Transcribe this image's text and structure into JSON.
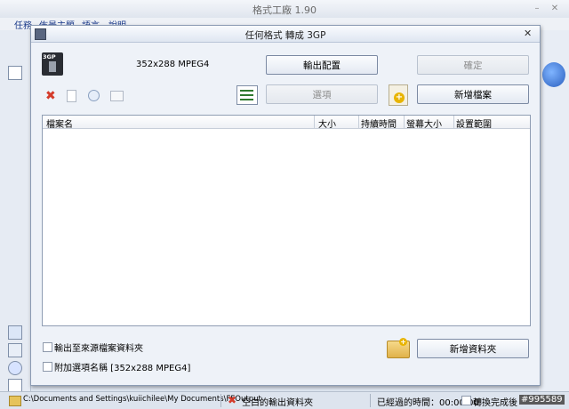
{
  "main_window": {
    "title": "格式工廠 1.90",
    "min_btn": "–",
    "close_btn": "✕",
    "menu": [
      "任務",
      "佈景主題",
      "語言",
      "說明"
    ]
  },
  "dialog": {
    "title": "任何格式 轉成 3GP",
    "format_badge": "3GP",
    "format_info": "352x288 MPEG4",
    "close_btn": "✕",
    "buttons": {
      "output_config": "輸出配置",
      "ok": "確定",
      "options": "選項",
      "add_file": "新增檔案",
      "add_folder": "新增資料夾"
    },
    "table": {
      "columns": [
        "檔案名",
        "大小",
        "持續時間",
        "螢幕大小",
        "設置範圍"
      ],
      "rows": []
    },
    "checkboxes": {
      "output_to_source": "輸出至來源檔案資料夾",
      "append_option_name": "附加選項名稱 [352x288 MPEG4]"
    }
  },
  "statusbar": {
    "output_path": "C:\\Documents and Settings\\kuiichilee\\My Documents\\FFOutput",
    "empty_output_folder": "空白的輸出資料夾",
    "elapsed_label": "已經過的時間：00:00:00",
    "shutdown_label": "轉換完成後",
    "watermark": "#995589"
  },
  "colors": {
    "accent": "#1b3a8a",
    "dialog_bg": "#eef2f8",
    "delete_red": "#d43b2a"
  }
}
